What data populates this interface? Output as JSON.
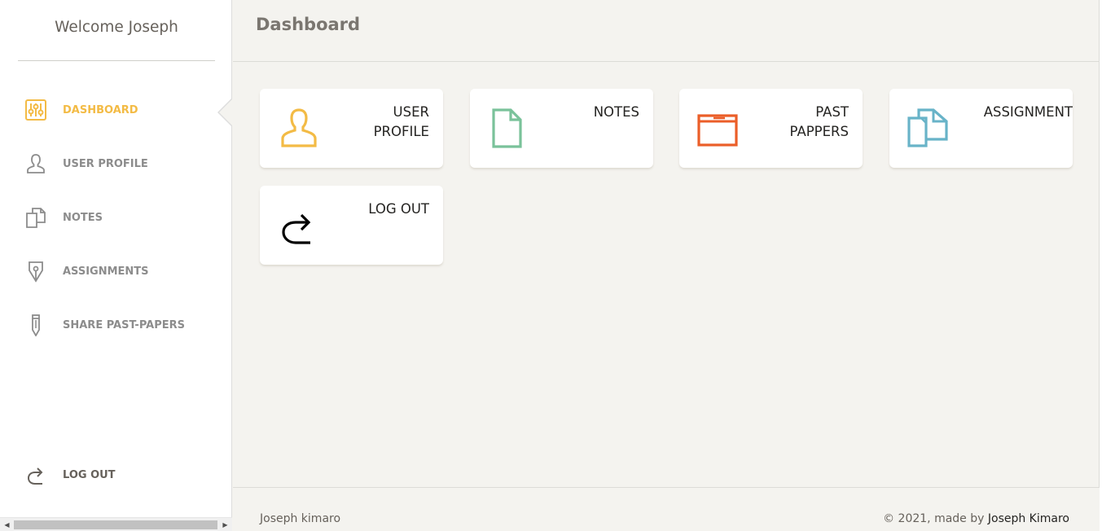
{
  "sidebar": {
    "welcome": "Welcome Joseph",
    "items": [
      {
        "label": "DASHBOARD",
        "icon": "sliders-icon",
        "active": true
      },
      {
        "label": "USER PROFILE",
        "icon": "user-icon"
      },
      {
        "label": "NOTES",
        "icon": "documents-icon"
      },
      {
        "label": "ASSIGNMENTS",
        "icon": "pen-nib-icon"
      },
      {
        "label": "SHARE PAST-PAPERS",
        "icon": "pencil-icon"
      }
    ],
    "logout": {
      "label": "LOG OUT",
      "icon": "redo-icon"
    }
  },
  "header": {
    "title": "Dashboard"
  },
  "cards": [
    {
      "label_line1": "USER",
      "label_line2": "PROFILE",
      "icon": "user-icon",
      "color": "#f3bb45"
    },
    {
      "label_line1": "NOTES",
      "label_line2": "",
      "icon": "file-icon",
      "color": "#7ac29a"
    },
    {
      "label_line1": "PAST",
      "label_line2": "PAPPERS",
      "icon": "folder-icon",
      "color": "#eb5e28"
    },
    {
      "label_line1": "ASSIGNMENT",
      "label_line2": "",
      "icon": "documents-icon",
      "color": "#68b3c8"
    },
    {
      "label_line1": "LOG OUT",
      "label_line2": "",
      "icon": "redo-icon",
      "color": "#000000"
    }
  ],
  "footer": {
    "left": "Joseph kimaro",
    "right_prefix": "© 2021, made by ",
    "right_author": "Joseph Kimaro"
  },
  "colors": {
    "accent": "#f3bb45",
    "background": "#f4f3ef",
    "sidebar_text": "#8c8c8c"
  }
}
